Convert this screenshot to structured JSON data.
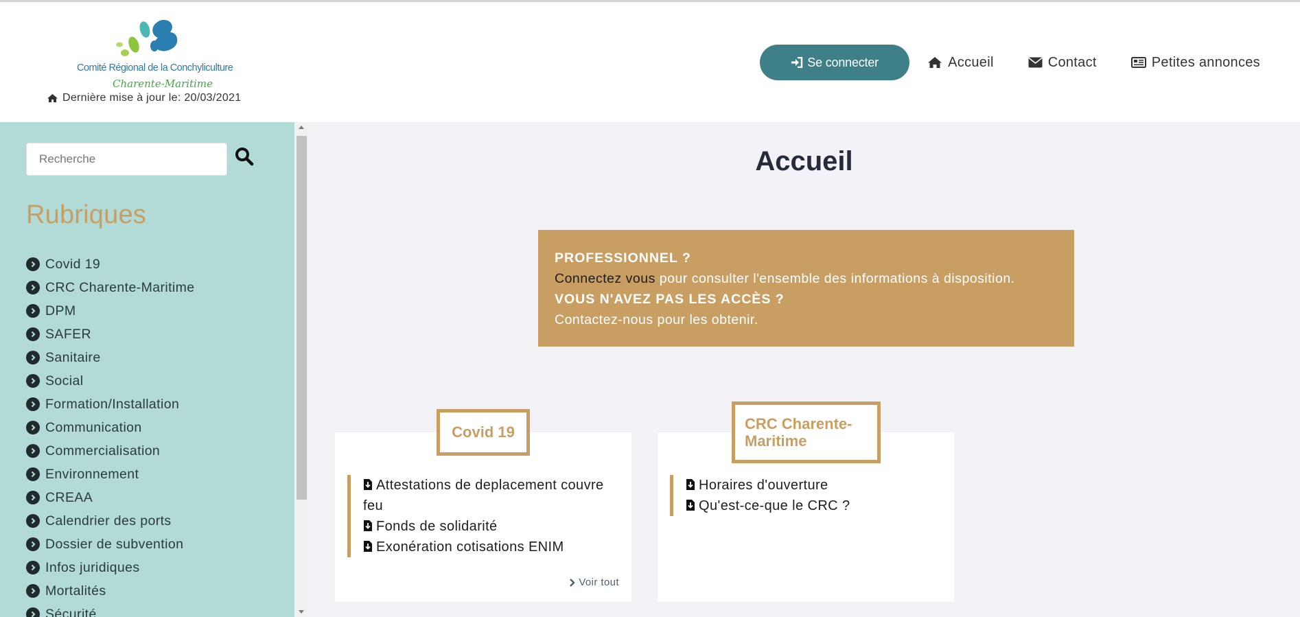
{
  "header": {
    "logo": {
      "line1": "Comité Régional de la Conchyliculture",
      "line2": "Charente-Maritime"
    },
    "update_text": "Dernière mise à jour le: 20/03/2021",
    "nav": {
      "connect": "Se connecter",
      "home": "Accueil",
      "contact": "Contact",
      "ads": "Petites annonces"
    }
  },
  "sidebar": {
    "search_placeholder": "Recherche",
    "heading": "Rubriques",
    "items": [
      "Covid 19",
      "CRC Charente-Maritime",
      "DPM",
      "SAFER",
      "Sanitaire",
      "Social",
      "Formation/Installation",
      "Communication",
      "Commercialisation",
      "Environnement",
      "CREAA",
      "Calendrier des ports",
      "Dossier de subvention",
      "Infos juridiques",
      "Mortalités",
      "Sécurité"
    ]
  },
  "main": {
    "title": "Accueil",
    "promo": {
      "q1": "PROFESSIONNEL ?",
      "link": "Connectez vous",
      "text1": " pour consulter l'ensemble des informations à disposition.",
      "q2": "VOUS N'AVEZ PAS LES ACCÈS ?",
      "text2": "Contactez-nous pour les obtenir."
    },
    "cards": [
      {
        "title": "Covid 19",
        "items": [
          "Attestations de deplacement couvre feu",
          "Fonds de solidarité",
          "Exonération cotisations ENIM"
        ],
        "more": "Voir tout"
      },
      {
        "title": "CRC Charente-Maritime",
        "items": [
          "Horaires d'ouverture",
          "Qu'est-ce-que le CRC ?"
        ]
      }
    ]
  },
  "colors": {
    "accent": "#c89e63",
    "button": "#3e7f88",
    "sidebar": "#b2dad7",
    "main_bg": "#f2f2f7"
  }
}
